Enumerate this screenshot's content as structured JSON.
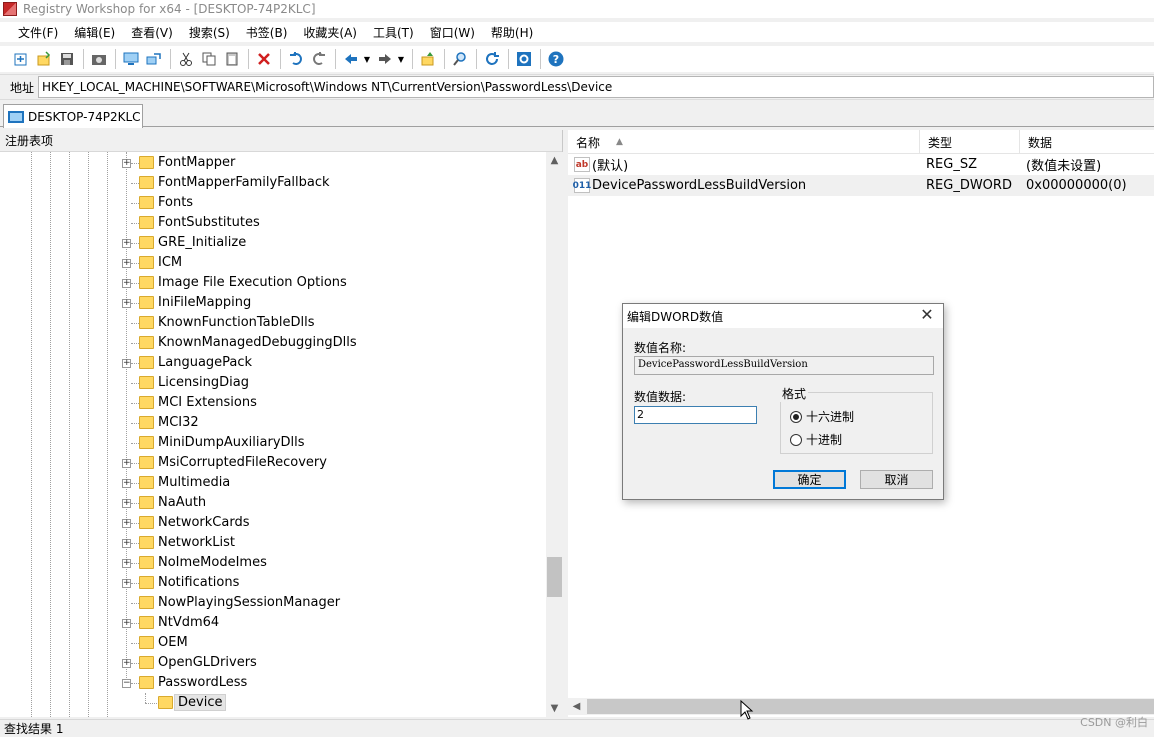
{
  "window": {
    "title": "Registry Workshop for x64 - [DESKTOP-74P2KLC]"
  },
  "menu": [
    "文件(F)",
    "编辑(E)",
    "查看(V)",
    "搜索(S)",
    "书签(B)",
    "收藏夹(A)",
    "工具(T)",
    "窗口(W)",
    "帮助(H)"
  ],
  "toolbar": {
    "buttons": [
      "new-key-icon",
      "import-icon",
      "save-icon",
      "snapshot-icon",
      "computer-icon",
      "connect-icon",
      "cut-icon",
      "copy-icon",
      "paste-icon",
      "delete-icon",
      "undo-icon",
      "redo-icon",
      "back-icon",
      "forward-icon",
      "up-icon",
      "find-icon",
      "refresh-icon",
      "settings-icon",
      "help-icon"
    ]
  },
  "address": {
    "label": "地址",
    "value": "HKEY_LOCAL_MACHINE\\SOFTWARE\\Microsoft\\Windows NT\\CurrentVersion\\PasswordLess\\Device"
  },
  "tab": {
    "label": "DESKTOP-74P2KLC"
  },
  "tree": {
    "header": "注册表项",
    "items": [
      {
        "label": "FontMapper",
        "expandable": true
      },
      {
        "label": "FontMapperFamilyFallback",
        "expandable": false
      },
      {
        "label": "Fonts",
        "expandable": false
      },
      {
        "label": "FontSubstitutes",
        "expandable": false
      },
      {
        "label": "GRE_Initialize",
        "expandable": true
      },
      {
        "label": "ICM",
        "expandable": true
      },
      {
        "label": "Image File Execution Options",
        "expandable": true
      },
      {
        "label": "IniFileMapping",
        "expandable": true
      },
      {
        "label": "KnownFunctionTableDlls",
        "expandable": false
      },
      {
        "label": "KnownManagedDebuggingDlls",
        "expandable": false
      },
      {
        "label": "LanguagePack",
        "expandable": true
      },
      {
        "label": "LicensingDiag",
        "expandable": false
      },
      {
        "label": "MCI Extensions",
        "expandable": false
      },
      {
        "label": "MCI32",
        "expandable": false
      },
      {
        "label": "MiniDumpAuxiliaryDlls",
        "expandable": false
      },
      {
        "label": "MsiCorruptedFileRecovery",
        "expandable": true
      },
      {
        "label": "Multimedia",
        "expandable": true
      },
      {
        "label": "NaAuth",
        "expandable": true
      },
      {
        "label": "NetworkCards",
        "expandable": true
      },
      {
        "label": "NetworkList",
        "expandable": true
      },
      {
        "label": "NoImeModeImes",
        "expandable": true
      },
      {
        "label": "Notifications",
        "expandable": true
      },
      {
        "label": "NowPlayingSessionManager",
        "expandable": false
      },
      {
        "label": "NtVdm64",
        "expandable": true
      },
      {
        "label": "OEM",
        "expandable": false
      },
      {
        "label": "OpenGLDrivers",
        "expandable": true
      },
      {
        "label": "PasswordLess",
        "expandable": true,
        "expanded": true
      }
    ],
    "child": {
      "label": "Device"
    }
  },
  "list": {
    "columns": [
      "名称",
      "类型",
      "数据"
    ],
    "rows": [
      {
        "icon": "ab",
        "name": "(默认)",
        "type": "REG_SZ",
        "data": "(数值未设置)"
      },
      {
        "icon": "011",
        "name": "DevicePasswordLessBuildVersion",
        "type": "REG_DWORD",
        "data": "0x00000000(0)"
      }
    ]
  },
  "status": {
    "text": "查找结果 1"
  },
  "watermark": "CSDN @利白",
  "dialog": {
    "title": "编辑DWORD数值",
    "name_label": "数值名称:",
    "name_value": "DevicePasswordLessBuildVersion",
    "data_label": "数值数据:",
    "data_value": "2",
    "format_label": "格式",
    "hex_label": "十六进制",
    "dec_label": "十进制",
    "ok_label": "确定",
    "cancel_label": "取消"
  }
}
